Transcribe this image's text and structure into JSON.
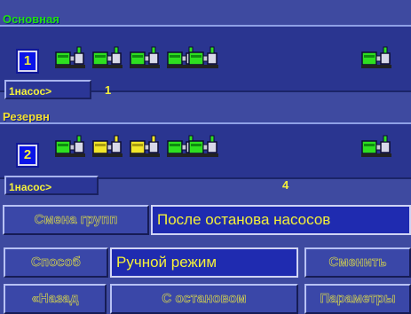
{
  "primary": {
    "title": "Основная",
    "group_number": "1",
    "pump_button": "1насос>",
    "count": "1",
    "pumps": [
      "green",
      "green",
      "green",
      "green",
      "green"
    ]
  },
  "reserve": {
    "title": "Резервн",
    "group_number": "2",
    "pump_button": "1насос>",
    "count": "4",
    "pumps": [
      "green",
      "yellow",
      "yellow",
      "green",
      "green"
    ]
  },
  "change_group": {
    "label": "Смена групп",
    "value": "После останова насосов"
  },
  "method": {
    "label": "Способ",
    "value": "Ручной режим",
    "action": "Сменить"
  },
  "bottom": {
    "back": "«Назад",
    "stop": "С остановом",
    "params": "Параметры"
  },
  "colors": {
    "pump_green": "#2ee020",
    "pump_yellow": "#f2e629",
    "text_yellow": "#f4f03a",
    "title_green": "#21e010"
  }
}
